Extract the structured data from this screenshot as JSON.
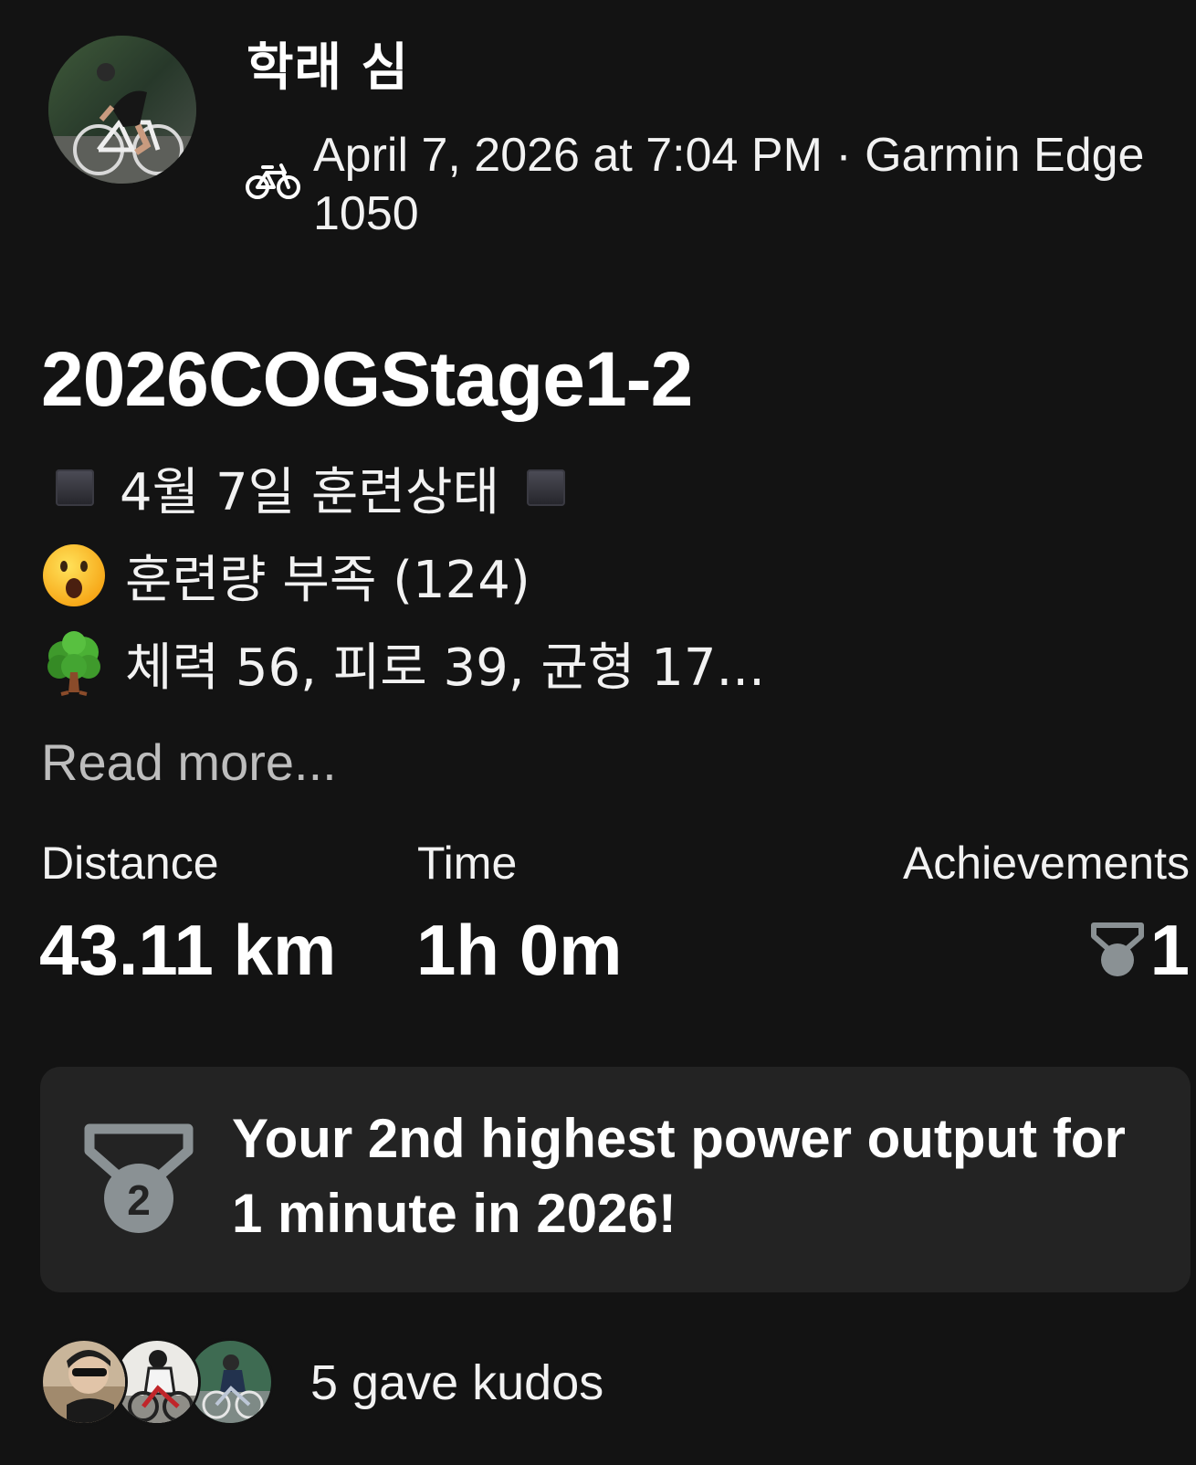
{
  "header": {
    "user_name": "학래 심",
    "activity_icon": "bike-icon",
    "meta_text": "April 7, 2026 at 7:04 PM · Garmin Edge 1050",
    "avatar_icon": "cyclist-avatar"
  },
  "activity": {
    "title": "2026COGStage1-2",
    "description_lines": [
      {
        "icon": "black-square-icon",
        "text": "4월 7일 훈련상태",
        "trailing_icon": "black-square-icon"
      },
      {
        "icon": "surprised-face-emoji",
        "text": "훈련량 부족 (124)"
      },
      {
        "icon": "tree-emoji",
        "text": "체력 56, 피로 39, 균형 17..."
      }
    ],
    "read_more": "Read more..."
  },
  "stats": {
    "distance": {
      "label": "Distance",
      "value": "43.11 km"
    },
    "time": {
      "label": "Time",
      "value": "1h 0m"
    },
    "achievements": {
      "label": "Achievements",
      "value": "1",
      "icon": "medal-icon"
    }
  },
  "achievement_card": {
    "medal_rank": "2",
    "icon": "silver-medal-icon",
    "text": "Your 2nd highest power output for 1 minute in 2026!"
  },
  "kudos": {
    "text": "5 gave kudos",
    "avatar_count_shown": 3
  },
  "colors": {
    "background": "#131313",
    "card": "#232323",
    "text_primary": "#ffffff",
    "text_secondary": "#bdbdbd",
    "medal_gray": "#8a9194"
  }
}
